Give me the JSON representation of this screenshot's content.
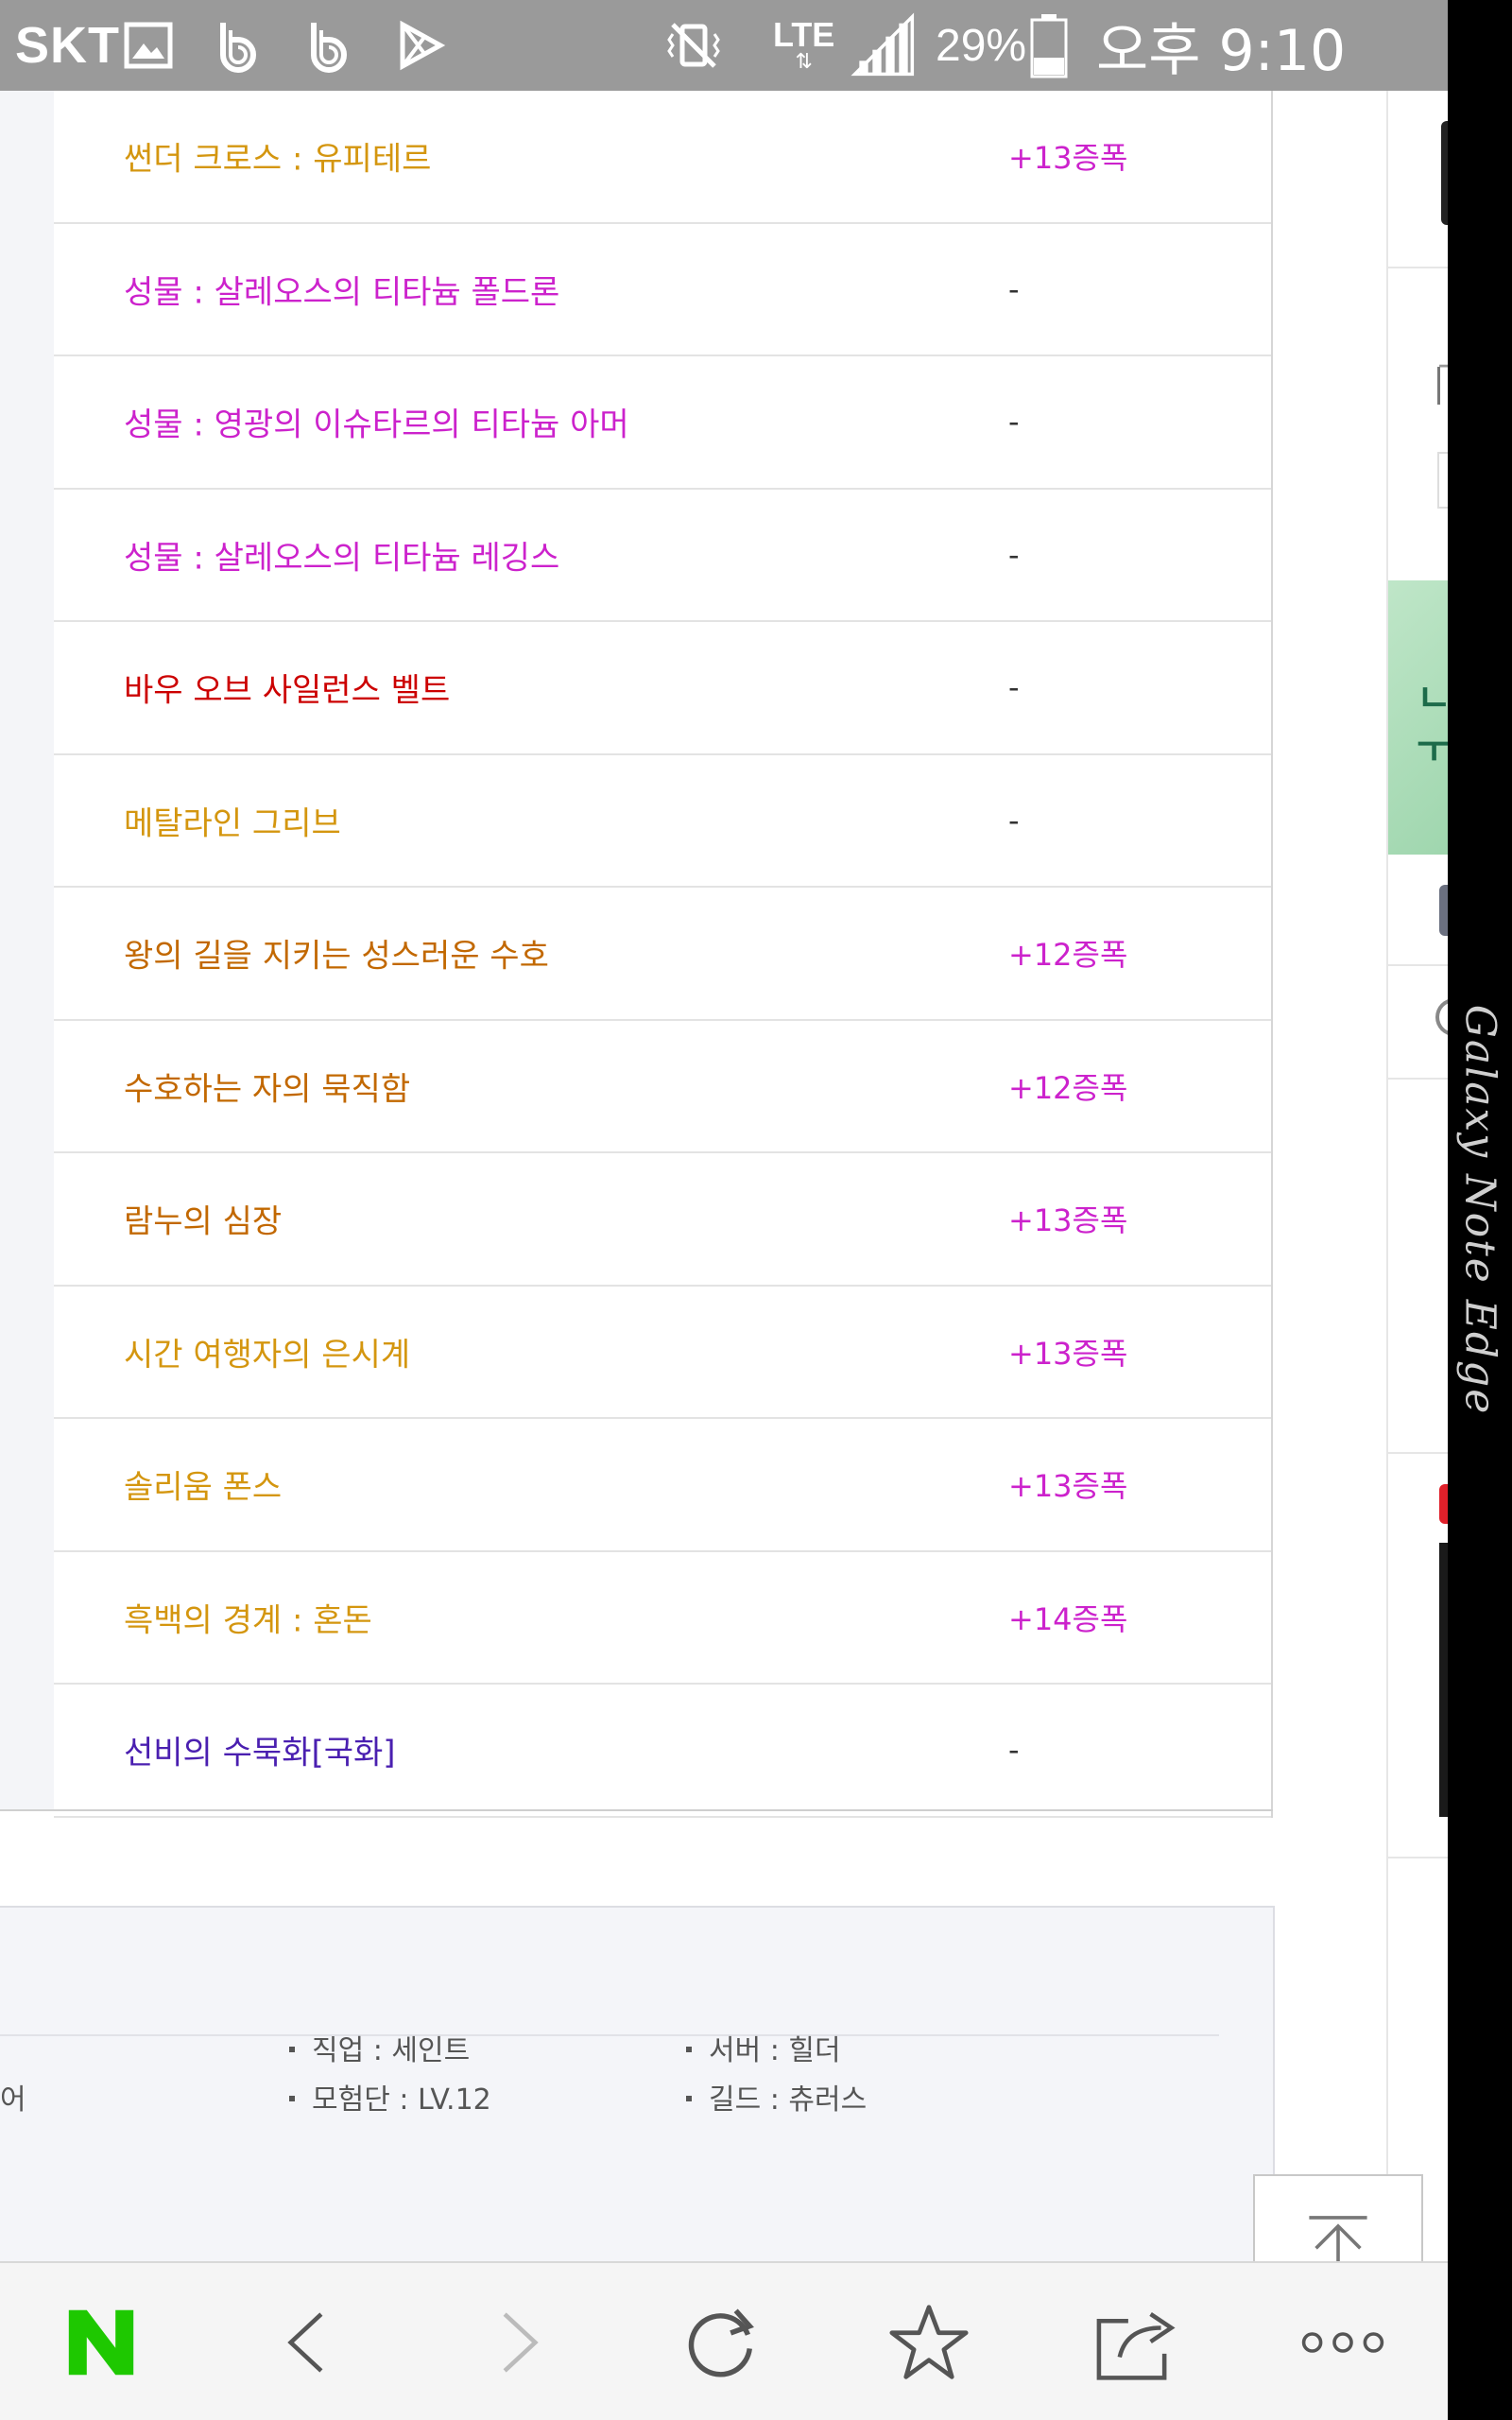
{
  "status_bar": {
    "carrier": "SKT",
    "network": "LTE",
    "battery": "29%",
    "time": "오후 9:10",
    "icons": [
      "gallery-icon",
      "b-app-icon",
      "b-app-icon",
      "play-store-icon",
      "vibrate-mute-icon",
      "lte-data-icon",
      "signal-icon",
      "battery-icon"
    ]
  },
  "edge_label": "Galaxy Note Edge",
  "colors": {
    "gold": "#d4960f",
    "magenta": "#cc22cc",
    "red": "#cc0000",
    "orange": "#c26800",
    "purple": "#4a1fb0",
    "enhance": "#cc22cc",
    "logo_green": "#1ec800"
  },
  "items": [
    {
      "name": "썬더 크로스 : 유피테르",
      "grade": "legendary",
      "enhance": "+13증폭"
    },
    {
      "name": "성물 : 살레오스의 티타늄 폴드론",
      "grade": "epic",
      "enhance": "-"
    },
    {
      "name": "성물 : 영광의 이슈타르의 티타늄 아머",
      "grade": "epic",
      "enhance": "-"
    },
    {
      "name": "성물 : 살레오스의 티타늄 레깅스",
      "grade": "epic",
      "enhance": "-"
    },
    {
      "name": "바우 오브 사일런스 벨트",
      "grade": "unique",
      "enhance": "-"
    },
    {
      "name": "메탈라인 그리브",
      "grade": "legendary",
      "enhance": "-"
    },
    {
      "name": "왕의 길을 지키는 성스러운 수호",
      "grade": "chronicle",
      "enhance": "+12증폭"
    },
    {
      "name": "수호하는 자의 묵직함",
      "grade": "chronicle",
      "enhance": "+12증폭"
    },
    {
      "name": "람누의 심장",
      "grade": "chronicle",
      "enhance": "+13증폭"
    },
    {
      "name": "시간 여행자의 은시계",
      "grade": "legendary",
      "enhance": "+13증폭"
    },
    {
      "name": "솔리움 폰스",
      "grade": "legendary",
      "enhance": "+13증폭"
    },
    {
      "name": "흑백의 경계 : 혼돈",
      "grade": "legendary",
      "enhance": "+14증폭"
    },
    {
      "name": "선비의 수묵화[국화]",
      "grade": "rare",
      "enhance": "-"
    }
  ],
  "profile": {
    "partial_left": "어",
    "job": "직업 : 세인트",
    "adventure": "모험단 : LV.12",
    "server": "서버 : 힐더",
    "guild": "길드 : 츄러스"
  },
  "bottom_nav": {
    "buttons": [
      "naver-home",
      "back",
      "forward",
      "refresh",
      "bookmark",
      "share",
      "more"
    ]
  }
}
